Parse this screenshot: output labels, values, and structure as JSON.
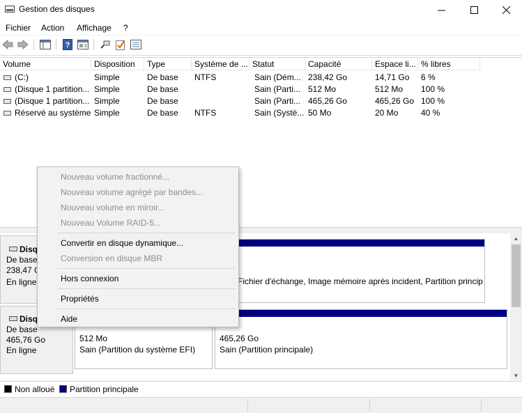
{
  "window": {
    "title": "Gestion des disques",
    "controls": {
      "minimize": "─",
      "maximize": "☐",
      "close": "✕"
    }
  },
  "menubar": [
    "Fichier",
    "Action",
    "Affichage",
    "?"
  ],
  "toolbar": {
    "icons": [
      "back-icon",
      "forward-icon",
      "console-tree-icon",
      "help-icon",
      "properties-icon",
      "connect-icon",
      "check-icon",
      "list-icon"
    ]
  },
  "volume_list": {
    "columns": [
      "Volume",
      "Disposition",
      "Type",
      "Système de ...",
      "Statut",
      "Capacité",
      "Espace li...",
      "% libres"
    ],
    "rows": [
      [
        "(C:)",
        "Simple",
        "De base",
        "NTFS",
        "Sain (Dém...",
        "238,42 Go",
        "14,71 Go",
        "6 %"
      ],
      [
        "(Disque 1 partition...",
        "Simple",
        "De base",
        "",
        "Sain (Parti...",
        "512 Mo",
        "512 Mo",
        "100 %"
      ],
      [
        "(Disque 1 partition...",
        "Simple",
        "De base",
        "",
        "Sain (Parti...",
        "465,26 Go",
        "465,26 Go",
        "100 %"
      ],
      [
        "Réservé au système",
        "Simple",
        "De base",
        "NTFS",
        "Sain (Systè...",
        "50 Mo",
        "20 Mo",
        "40 %"
      ]
    ]
  },
  "disks": [
    {
      "name": "Disq",
      "type": "De base",
      "size": "238,47 Go",
      "state": "En ligne",
      "partition_text": "Fichier d'échange, Image mémoire après incident, Partition princip"
    },
    {
      "name": "Disq",
      "type": "De base",
      "size": "465,76 Go",
      "state": "En ligne",
      "partitions": [
        {
          "size": "512 Mo",
          "status": "Sain (Partition du système EFI)"
        },
        {
          "size": "465,26 Go",
          "status": "Sain (Partition principale)"
        }
      ]
    }
  ],
  "legend": [
    {
      "label": "Non alloué",
      "color": "#000000"
    },
    {
      "label": "Partition principale",
      "color": "#000080"
    }
  ],
  "context_menu": {
    "items": [
      {
        "label": "Nouveau volume fractionné...",
        "enabled": false
      },
      {
        "label": "Nouveau volume agrégé par bandes...",
        "enabled": false
      },
      {
        "label": "Nouveau volume en miroir...",
        "enabled": false
      },
      {
        "label": "Nouveau Volume RAID-5...",
        "enabled": false
      },
      {
        "label": "Convertir en disque dynamique...",
        "enabled": true
      },
      {
        "label": "Conversion en disque MBR",
        "enabled": false
      },
      {
        "label": "Hors connexion",
        "enabled": true
      },
      {
        "label": "Propriétés",
        "enabled": true
      },
      {
        "label": "Aide",
        "enabled": true
      }
    ]
  },
  "colors": {
    "primary_partition": "#000080",
    "unallocated": "#000000",
    "disabled_text": "#8d8d8d"
  }
}
